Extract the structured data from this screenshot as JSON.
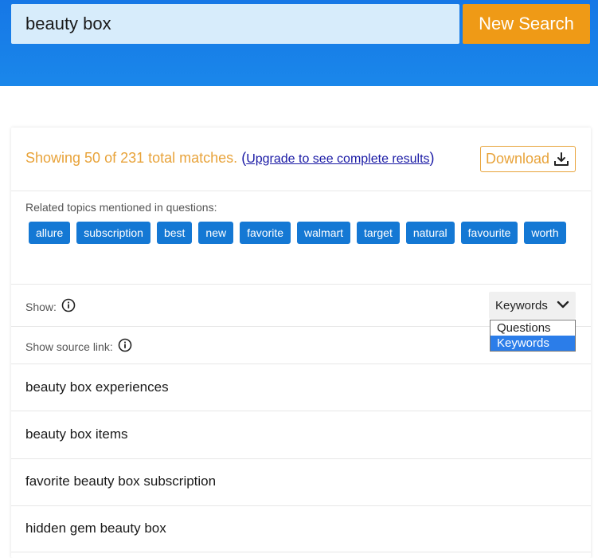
{
  "search": {
    "value": "beauty box",
    "button_label": "New Search"
  },
  "results": {
    "summary_text": "Showing 50 of 231 total matches.",
    "paren_open": "(",
    "upgrade_link": "Upgrade to see complete results",
    "paren_close": ")",
    "download_label": "Download",
    "related_label": "Related topics mentioned in questions:",
    "tags": [
      "allure",
      "subscription",
      "best",
      "new",
      "favorite",
      "walmart",
      "target",
      "natural",
      "favourite",
      "worth"
    ],
    "show_label": "Show:",
    "show_select_value": "Keywords",
    "show_options": [
      "Questions",
      "Keywords"
    ],
    "source_link_label": "Show source link:",
    "items": [
      "beauty box experiences",
      "beauty box items",
      "favorite beauty box subscription",
      "hidden gem beauty box"
    ]
  },
  "colors": {
    "header_blue": "#1677e6",
    "accent_orange": "#ef9a16",
    "tag_blue": "#1478d4",
    "summary_orange": "#e8a33a"
  }
}
